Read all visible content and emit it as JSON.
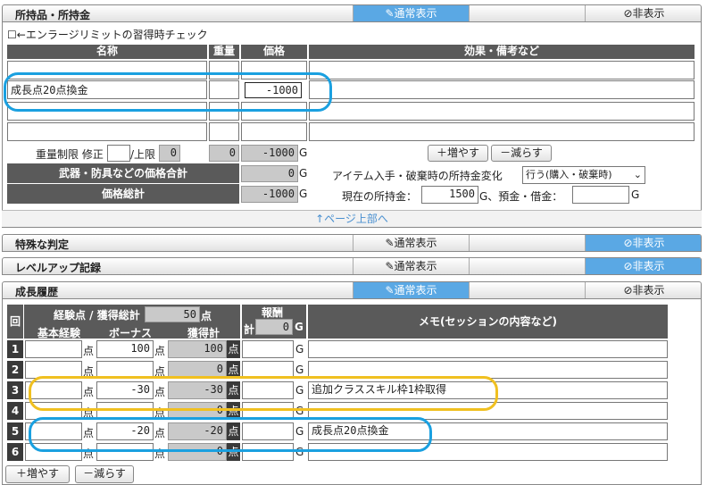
{
  "colors": {
    "accent": "#5aa8e4",
    "blue_highlight": "#1aa0e0",
    "yellow_highlight": "#f0c020",
    "header_bg": "#5a5a5a"
  },
  "items_section": {
    "title": "所持品・所持金",
    "tab_normal": "通常表示",
    "tab_hidden": "⊘非表示",
    "enlarge_check_label": "☐←エンラージリミットの習得時チェック",
    "col_name": "名称",
    "col_weight": "重量",
    "col_price": "価格",
    "col_effect": "効果・備考など",
    "rows": [
      {
        "name": "",
        "weight": "",
        "price": "",
        "effect": ""
      },
      {
        "name": "成長点20点換金",
        "weight": "",
        "price": "-1000",
        "effect": ""
      },
      {
        "name": "",
        "weight": "",
        "price": "",
        "effect": ""
      },
      {
        "name": "",
        "weight": "",
        "price": "",
        "effect": ""
      }
    ],
    "weight_limit_label": "重量制限 修正",
    "weight_upper_label": "/上限",
    "weight_upper_value": "0",
    "weight_total": "0",
    "price_total_row1": "-1000",
    "g": "G",
    "add_button": "＋増やす",
    "remove_button": "－減らす",
    "weapon_total_label": "武器・防具などの価格合計",
    "weapon_total_value": "0",
    "price_grand_label": "価格総計",
    "price_grand_value": "-1000",
    "money_change_label": "アイテム入手・破棄時の所持金変化",
    "money_change_select": "行う(購入・破棄時)",
    "current_money_label": "現在の所持金：",
    "current_money_value": "1500",
    "deposit_label": "G、預金・借金：",
    "deposit_value": "",
    "page_top_link": "↑ページ上部へ"
  },
  "special_section": {
    "title": "特殊な判定",
    "tab_normal": "通常表示",
    "tab_hidden": "⊘非表示"
  },
  "levelup_section": {
    "title": "レベルアップ記録",
    "tab_normal": "通常表示",
    "tab_hidden": "⊘非表示"
  },
  "growth_section": {
    "title": "成長履歴",
    "tab_normal": "通常表示",
    "tab_hidden": "⊘非表示",
    "col_round": "回",
    "exp_total_label": "経験点 / 獲得総計",
    "exp_total_value": "50",
    "pt": "点",
    "col_base": "基本経験",
    "col_bonus": "ボーナス",
    "col_gain_total": "獲得計",
    "reward_label": "報酬",
    "reward_total_label": "計",
    "reward_total_value": "0",
    "g": "G",
    "memo_header": "メモ(セッションの内容など)",
    "rows": [
      {
        "no": "1",
        "base": "",
        "bonus": "100",
        "total": "100",
        "reward": "",
        "memo": ""
      },
      {
        "no": "2",
        "base": "",
        "bonus": "",
        "total": "0",
        "reward": "",
        "memo": ""
      },
      {
        "no": "3",
        "base": "",
        "bonus": "-30",
        "total": "-30",
        "reward": "",
        "memo": "追加クラススキル枠1枠取得"
      },
      {
        "no": "4",
        "base": "",
        "bonus": "",
        "total": "0",
        "reward": "",
        "memo": ""
      },
      {
        "no": "5",
        "base": "",
        "bonus": "-20",
        "total": "-20",
        "reward": "",
        "memo": "成長点20点換金"
      },
      {
        "no": "6",
        "base": "",
        "bonus": "",
        "total": "0",
        "reward": "",
        "memo": ""
      }
    ],
    "add_button": "＋増やす",
    "remove_button": "－減らす"
  }
}
